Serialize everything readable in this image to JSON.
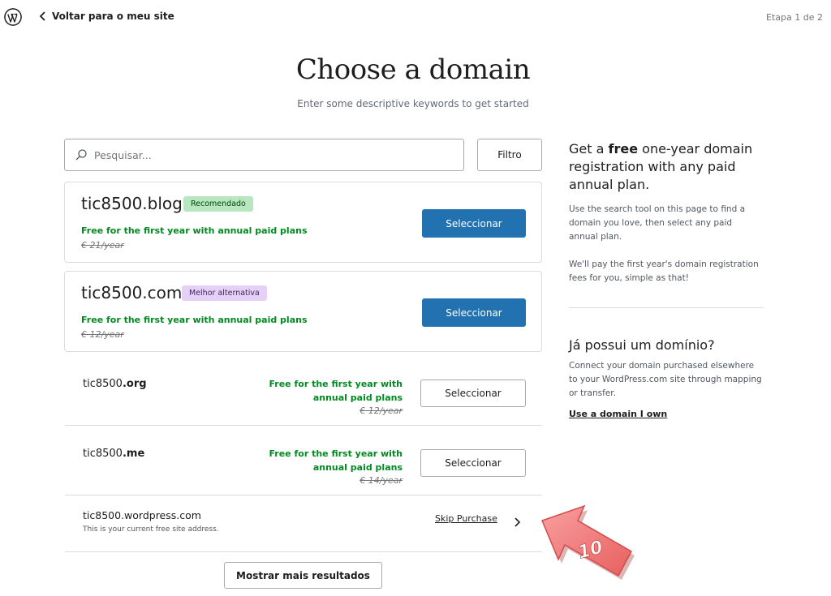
{
  "header": {
    "back_label": "Voltar para o meu site",
    "step": "Etapa 1 de 2"
  },
  "page": {
    "title": "Choose a domain",
    "subtitle": "Enter some descriptive keywords to get started"
  },
  "search": {
    "placeholder": "Pesquisar...",
    "filter_label": "Filtro"
  },
  "featured": [
    {
      "domain": "tic8500.blog",
      "badge": "Recomendado",
      "free_text": "Free for the first year with annual paid plans",
      "price": "€ 21/year",
      "button": "Seleccionar"
    },
    {
      "domain": "tic8500.com",
      "badge": "Melhor alternativa",
      "free_text": "Free for the first year with annual paid plans",
      "price": "€ 12/year",
      "button": "Seleccionar"
    }
  ],
  "results": [
    {
      "name": "tic8500",
      "tld": ".org",
      "free_line1": "Free for the first year with",
      "free_line2": "annual paid plans",
      "price": "€ 12/year",
      "button": "Seleccionar"
    },
    {
      "name": "tic8500",
      "tld": ".me",
      "free_line1": "Free for the first year with",
      "free_line2": "annual paid plans",
      "price": "€ 14/year",
      "button": "Seleccionar"
    }
  ],
  "free_site": {
    "domain": "tic8500.wordpress.com",
    "note": "This is your current free site address.",
    "skip_label": "Skip Purchase"
  },
  "more_button": "Mostrar mais resultados",
  "promo": {
    "title_prefix": "Get a ",
    "title_bold": "free",
    "title_suffix": " one-year domain registration with any paid annual plan.",
    "p1": "Use the search tool on this page to find a domain you love, then select any paid annual plan.",
    "p2": "We'll pay the first year's domain registration fees for you, simple as that!"
  },
  "own_domain": {
    "title": "Já possui um domínio?",
    "text": "Connect your domain purchased elsewhere to your WordPress.com site through mapping or transfer.",
    "link": "Use a domain I own"
  },
  "annotation": {
    "number": "10",
    "color": "#f47c7c"
  },
  "colors": {
    "primary": "#2271b1",
    "green_text": "#008a20"
  },
  "icons": [
    "wordpress-logo-icon",
    "chevron-left-icon",
    "search-icon",
    "chevron-right-icon"
  ]
}
